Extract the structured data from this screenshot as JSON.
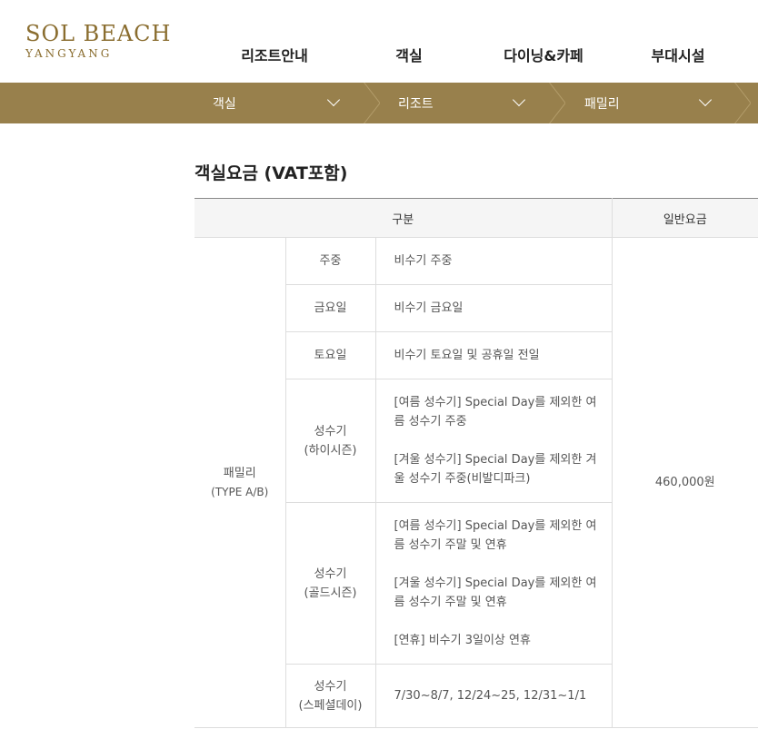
{
  "brand": {
    "name": "SOL BEACH",
    "location": "YANGYANG"
  },
  "gnb": [
    "리조트안내",
    "객실",
    "다이닝&카페",
    "부대시설"
  ],
  "location_bar": [
    "객실",
    "리조트",
    "패밀리"
  ],
  "section_title": "객실요금 (VAT포함)",
  "table": {
    "headers": {
      "category": "구분",
      "price": "일반요금"
    },
    "room": {
      "name": "패밀리",
      "type": "(TYPE A/B)"
    },
    "price": "460,000원",
    "rows": [
      {
        "day": "주중",
        "desc": [
          "비수기 주중"
        ]
      },
      {
        "day": "금요일",
        "desc": [
          "비수기 금요일"
        ]
      },
      {
        "day": "토요일",
        "desc": [
          "비수기 토요일 및 공휴일 전일"
        ]
      },
      {
        "day": "성수기",
        "day_sub": "(하이시즌)",
        "desc": [
          "[여름 성수기] Special Day를 제외한 여름 성수기 주중",
          "[겨울 성수기] Special Day를 제외한 겨울 성수기 주중(비발디파크)"
        ]
      },
      {
        "day": "성수기",
        "day_sub": "(골드시즌)",
        "desc": [
          "[여름 성수기] Special Day를 제외한 여름 성수기 주말 및 연휴",
          "[겨울 성수기] Special Day를 제외한 여름 성수기 주말 및 연휴",
          "[연휴] 비수기 3일이상 연휴"
        ]
      },
      {
        "day": "성수기",
        "day_sub": "(스페셜데이)",
        "desc": [
          "7/30~8/7, 12/24~25, 12/31~1/1"
        ]
      }
    ]
  },
  "colors": {
    "brand_gold": "#8a6d2f",
    "bar_bg": "#98804c"
  }
}
